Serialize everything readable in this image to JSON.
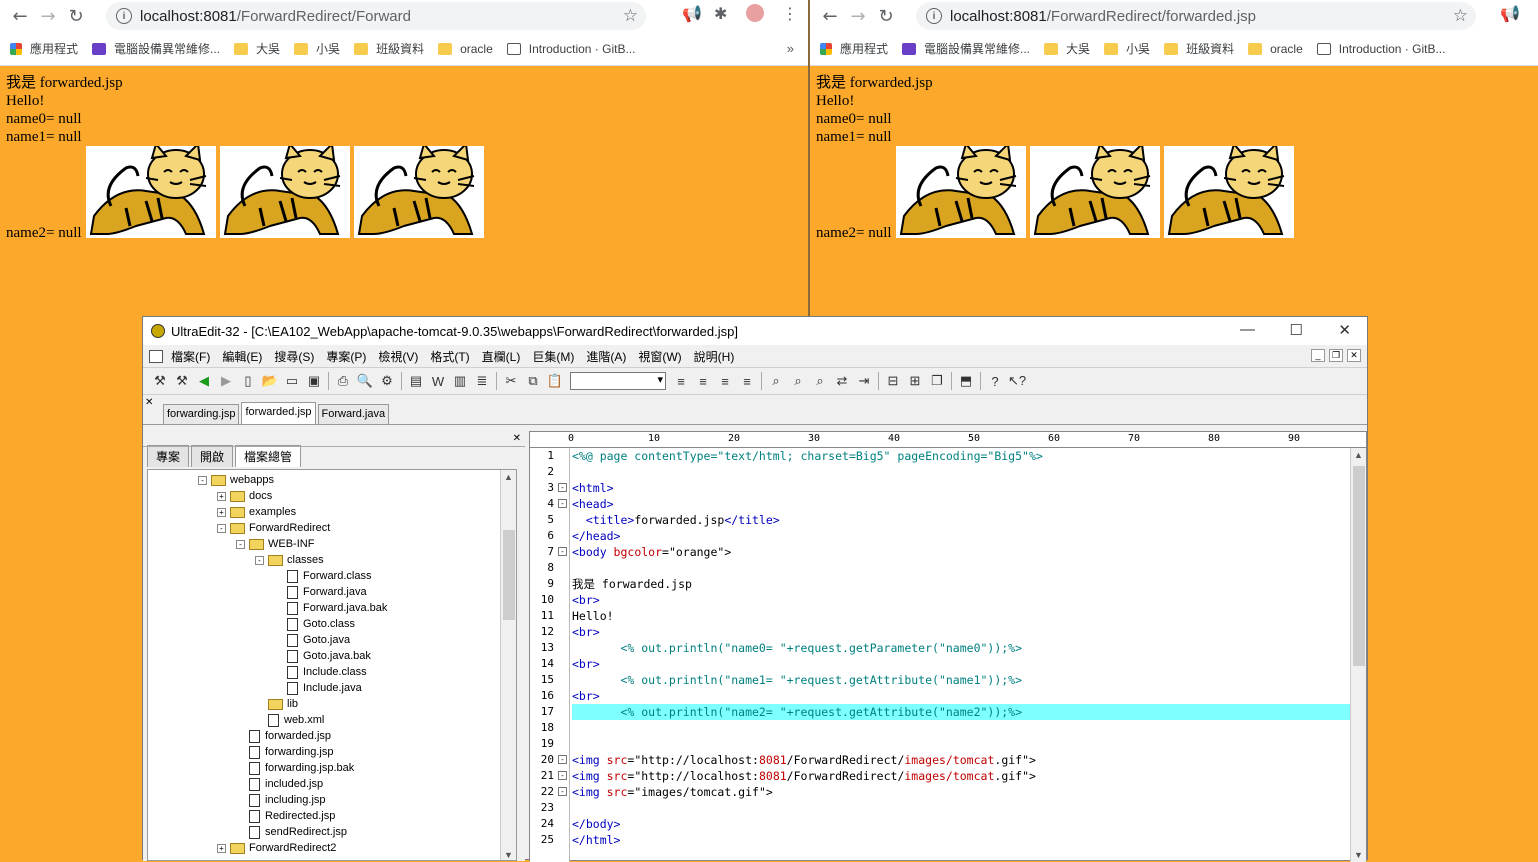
{
  "left_browser": {
    "url_host": "localhost:8081",
    "url_path": "/ForwardRedirect/Forward",
    "bookmarks": [
      "應用程式",
      "電腦設備異常維修...",
      "大吳",
      "小吳",
      "班級資料",
      "oracle",
      "Introduction · GitB..."
    ],
    "bookmarks_more": "»",
    "lines": [
      "我是 forwarded.jsp",
      "Hello!",
      "name0= null",
      "name1= null"
    ],
    "last_line": "name2= null"
  },
  "right_browser": {
    "url_host": "localhost:8081",
    "url_path": "/ForwardRedirect/forwarded.jsp",
    "bookmarks": [
      "應用程式",
      "電腦設備異常維修...",
      "大吳",
      "小吳",
      "班級資料",
      "oracle",
      "Introduction · GitB..."
    ],
    "lines": [
      "我是 forwarded.jsp",
      "Hello!",
      "name0= null",
      "name1= null"
    ],
    "last_line": "name2= null"
  },
  "ultraedit": {
    "title": "UltraEdit-32 - [C:\\EA102_WebApp\\apache-tomcat-9.0.35\\webapps\\ForwardRedirect\\forwarded.jsp]",
    "menu": [
      "檔案(F)",
      "編輯(E)",
      "搜尋(S)",
      "專案(P)",
      "檢視(V)",
      "格式(T)",
      "直欄(L)",
      "巨集(M)",
      "進階(A)",
      "視窗(W)",
      "說明(H)"
    ],
    "tabs": [
      "forwarding.jsp",
      "forwarded.jsp",
      "Forward.java"
    ],
    "active_tab": "forwarded.jsp",
    "panel_tabs": [
      "專案",
      "開啟",
      "檔案總管"
    ],
    "tree": [
      {
        "label": "webapps",
        "depth": 0,
        "kind": "folder",
        "pm": "-"
      },
      {
        "label": "docs",
        "depth": 1,
        "kind": "folder",
        "pm": "+"
      },
      {
        "label": "examples",
        "depth": 1,
        "kind": "folder",
        "pm": "+"
      },
      {
        "label": "ForwardRedirect",
        "depth": 1,
        "kind": "folder",
        "pm": "-"
      },
      {
        "label": "WEB-INF",
        "depth": 2,
        "kind": "folder",
        "pm": "-"
      },
      {
        "label": "classes",
        "depth": 3,
        "kind": "folder",
        "pm": "-"
      },
      {
        "label": "Forward.class",
        "depth": 4,
        "kind": "file"
      },
      {
        "label": "Forward.java",
        "depth": 4,
        "kind": "file"
      },
      {
        "label": "Forward.java.bak",
        "depth": 4,
        "kind": "file"
      },
      {
        "label": "Goto.class",
        "depth": 4,
        "kind": "file"
      },
      {
        "label": "Goto.java",
        "depth": 4,
        "kind": "file"
      },
      {
        "label": "Goto.java.bak",
        "depth": 4,
        "kind": "file"
      },
      {
        "label": "Include.class",
        "depth": 4,
        "kind": "file"
      },
      {
        "label": "Include.java",
        "depth": 4,
        "kind": "file"
      },
      {
        "label": "lib",
        "depth": 3,
        "kind": "folder"
      },
      {
        "label": "web.xml",
        "depth": 3,
        "kind": "file"
      },
      {
        "label": "forwarded.jsp",
        "depth": 2,
        "kind": "file"
      },
      {
        "label": "forwarding.jsp",
        "depth": 2,
        "kind": "file"
      },
      {
        "label": "forwarding.jsp.bak",
        "depth": 2,
        "kind": "file"
      },
      {
        "label": "included.jsp",
        "depth": 2,
        "kind": "file"
      },
      {
        "label": "including.jsp",
        "depth": 2,
        "kind": "file"
      },
      {
        "label": "Redirected.jsp",
        "depth": 2,
        "kind": "file"
      },
      {
        "label": "sendRedirect.jsp",
        "depth": 2,
        "kind": "file"
      },
      {
        "label": "ForwardRedirect2",
        "depth": 1,
        "kind": "folder",
        "pm": "+"
      }
    ],
    "ruler": [
      "0",
      "10",
      "20",
      "30",
      "40",
      "50",
      "60",
      "70",
      "80",
      "90"
    ],
    "code": [
      {
        "n": "1",
        "t": [
          [
            "jsp",
            "<%@ page contentType=\"text/html; charset=Big5\" pageEncoding=\"Big5\"%>"
          ]
        ]
      },
      {
        "n": "2",
        "t": []
      },
      {
        "n": "3",
        "f": "-",
        "t": [
          [
            "tag",
            "<html>"
          ]
        ]
      },
      {
        "n": "4",
        "f": "-",
        "t": [
          [
            "tag",
            "<head>"
          ]
        ]
      },
      {
        "n": "5",
        "t": [
          [
            "tag",
            "  <title>"
          ],
          [
            "val",
            "forwarded.jsp"
          ],
          [
            "tag",
            "</title>"
          ]
        ]
      },
      {
        "n": "6",
        "t": [
          [
            "tag",
            "</head>"
          ]
        ]
      },
      {
        "n": "7",
        "f": "-",
        "t": [
          [
            "tag",
            "<body "
          ],
          [
            "attr",
            "bgcolor"
          ],
          [
            "val",
            "=\"orange\">"
          ]
        ]
      },
      {
        "n": "8",
        "t": []
      },
      {
        "n": "9",
        "t": [
          [
            "val",
            "我是 forwarded.jsp"
          ]
        ]
      },
      {
        "n": "10",
        "t": [
          [
            "tag",
            "<br>"
          ]
        ]
      },
      {
        "n": "11",
        "t": [
          [
            "val",
            "Hello!"
          ]
        ]
      },
      {
        "n": "12",
        "t": [
          [
            "tag",
            "<br>"
          ]
        ]
      },
      {
        "n": "13",
        "t": [
          [
            "jsp",
            "       <% out.println(\"name0= \"+request.getParameter(\"name0\"));%>"
          ]
        ]
      },
      {
        "n": "14",
        "t": [
          [
            "tag",
            "<br>"
          ]
        ]
      },
      {
        "n": "15",
        "t": [
          [
            "jsp",
            "       <% out.println(\"name1= \"+request.getAttribute(\"name1\"));%>"
          ]
        ]
      },
      {
        "n": "16",
        "t": [
          [
            "tag",
            "<br>"
          ]
        ]
      },
      {
        "n": "17",
        "hl": true,
        "t": [
          [
            "jsp",
            "       <% out.println(\"name2= \"+request.getAttribute(\"name2\"));%>"
          ]
        ]
      },
      {
        "n": "18",
        "t": []
      },
      {
        "n": "19",
        "t": []
      },
      {
        "n": "20",
        "f": "-",
        "t": [
          [
            "tag",
            "<img "
          ],
          [
            "attr",
            "src"
          ],
          [
            "val",
            "=\"http://localhost:"
          ],
          [
            "attr",
            "8081"
          ],
          [
            "val",
            "/ForwardRedirect/"
          ],
          [
            "attr",
            "images/tomcat"
          ],
          [
            "val",
            ".gif\">"
          ]
        ]
      },
      {
        "n": "21",
        "f": "-",
        "t": [
          [
            "tag",
            "<img "
          ],
          [
            "attr",
            "src"
          ],
          [
            "val",
            "=\"http://localhost:"
          ],
          [
            "attr",
            "8081"
          ],
          [
            "val",
            "/ForwardRedirect/"
          ],
          [
            "attr",
            "images/tomcat"
          ],
          [
            "val",
            ".gif\">"
          ]
        ]
      },
      {
        "n": "22",
        "f": "-",
        "t": [
          [
            "tag",
            "<img "
          ],
          [
            "attr",
            "src"
          ],
          [
            "val",
            "=\"images/tomcat.gif\">"
          ]
        ]
      },
      {
        "n": "23",
        "t": []
      },
      {
        "n": "24",
        "t": [
          [
            "tag",
            "</body>"
          ]
        ]
      },
      {
        "n": "25",
        "t": [
          [
            "tag",
            "</html>"
          ]
        ]
      }
    ]
  },
  "colors": {
    "page_bg": "#fba82b",
    "highlight": "#7fffff",
    "tag": "#0000c0",
    "attr": "#c00000",
    "jsp": "#008080"
  }
}
